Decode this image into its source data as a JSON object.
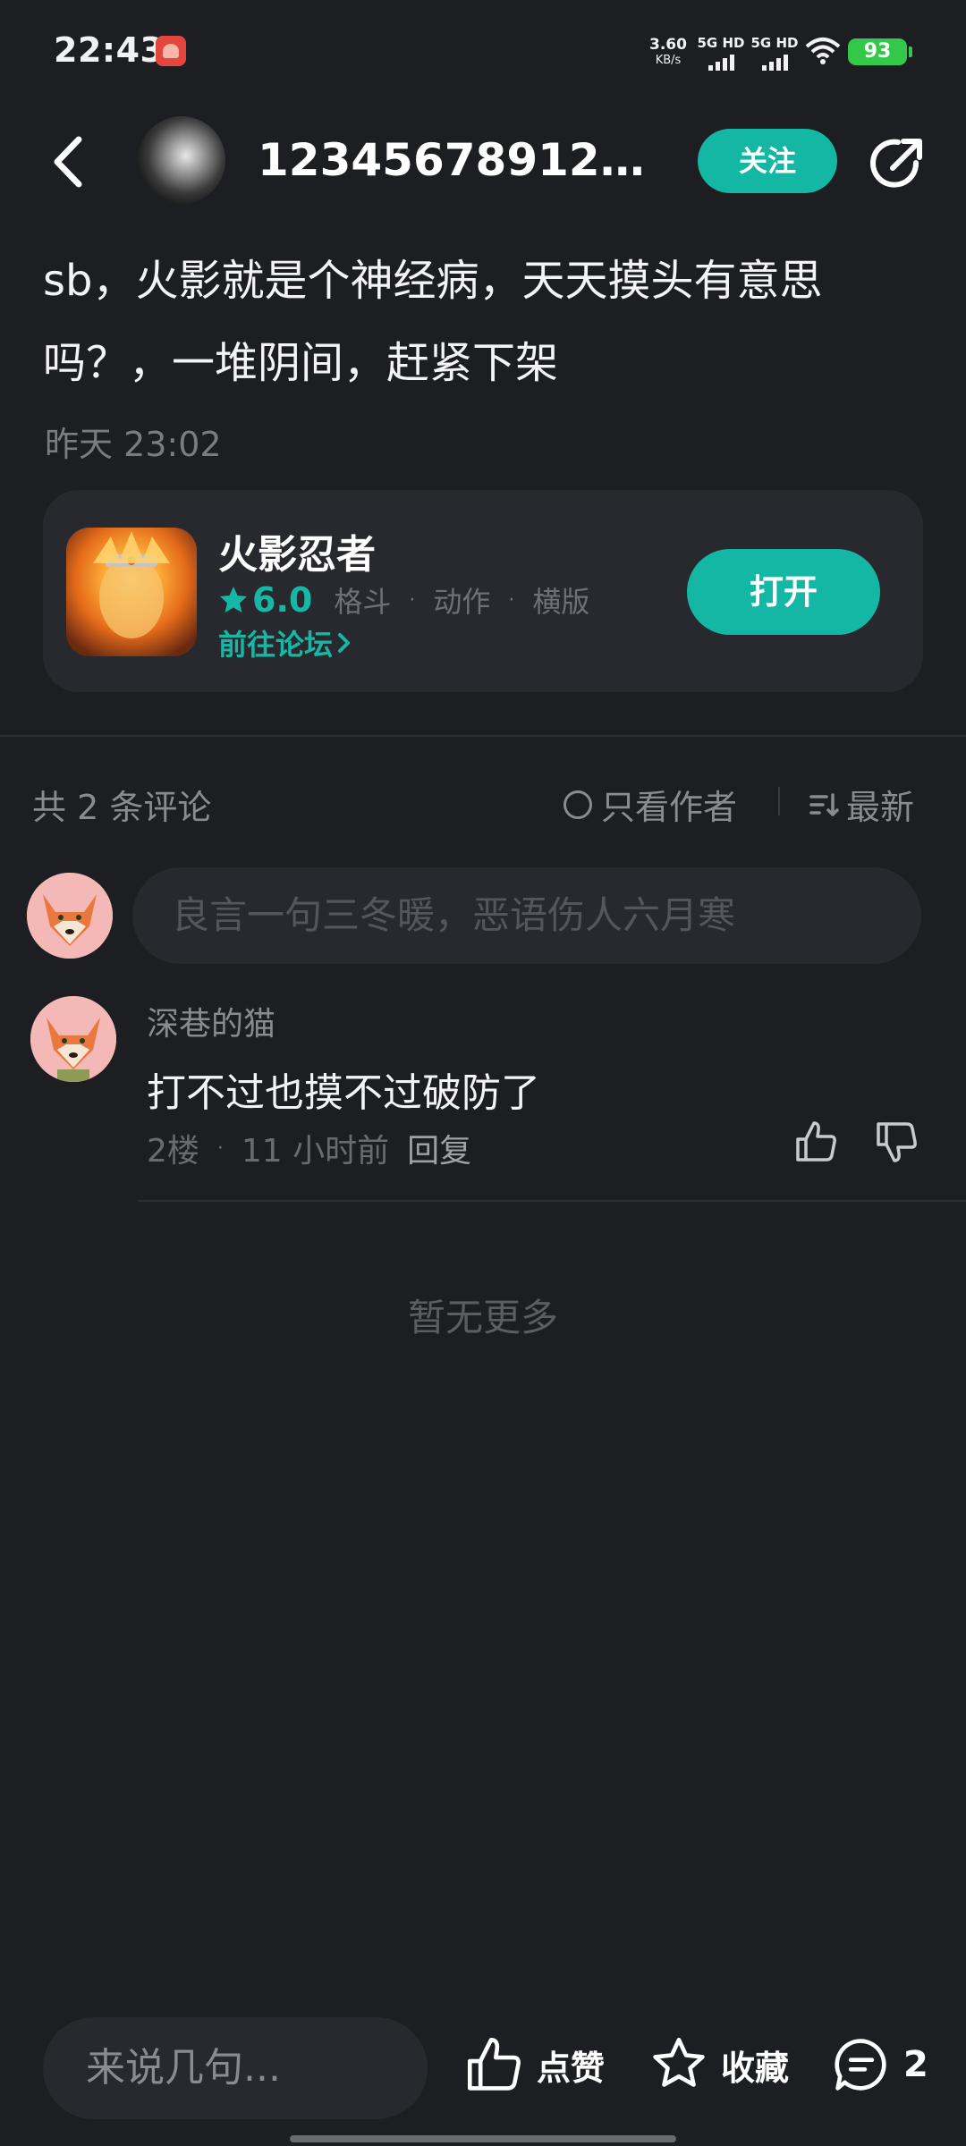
{
  "status_bar": {
    "time": "22:43",
    "net_speed_value": "3.60",
    "net_speed_unit": "KB/s",
    "signal_1": "5G HD",
    "signal_2": "5G HD",
    "battery": "93"
  },
  "header": {
    "author_name": "1234567891234…",
    "follow_label": "关注"
  },
  "post": {
    "text": "sb，火影就是个神经病，天天摸头有意思吗？，一堆阴间，赶紧下架",
    "time": "昨天 23:02"
  },
  "game_card": {
    "title": "火影忍者",
    "score": "6.0",
    "tags": [
      "格斗",
      "动作",
      "横版"
    ],
    "forum_link": "前往论坛",
    "open_label": "打开"
  },
  "comments_header": {
    "count": "共 2 条评论",
    "only_author": "只看作者",
    "sort": "最新"
  },
  "comment_input_placeholder": "良言一句三冬暖，恶语伤人六月寒",
  "comments": [
    {
      "user": "深巷的猫",
      "text": "打不过也摸不过破防了",
      "floor": "2楼",
      "time": "11 小时前",
      "reply": "回复"
    }
  ],
  "no_more": "暂无更多",
  "bottom_bar": {
    "input_placeholder": "来说几句...",
    "like_label": "点赞",
    "favorite_label": "收藏",
    "comment_count": "2"
  },
  "colors": {
    "background": "#1d1e22",
    "accent": "#13b7a4",
    "card": "#28292e",
    "battery": "#34c84a"
  },
  "icons": [
    "back-icon",
    "share-icon",
    "star-icon",
    "chevron-right-icon",
    "circle-icon",
    "sort-icon",
    "thumbs-up-icon",
    "thumbs-down-icon",
    "star-outline-icon",
    "comment-icon",
    "wifi-icon"
  ]
}
